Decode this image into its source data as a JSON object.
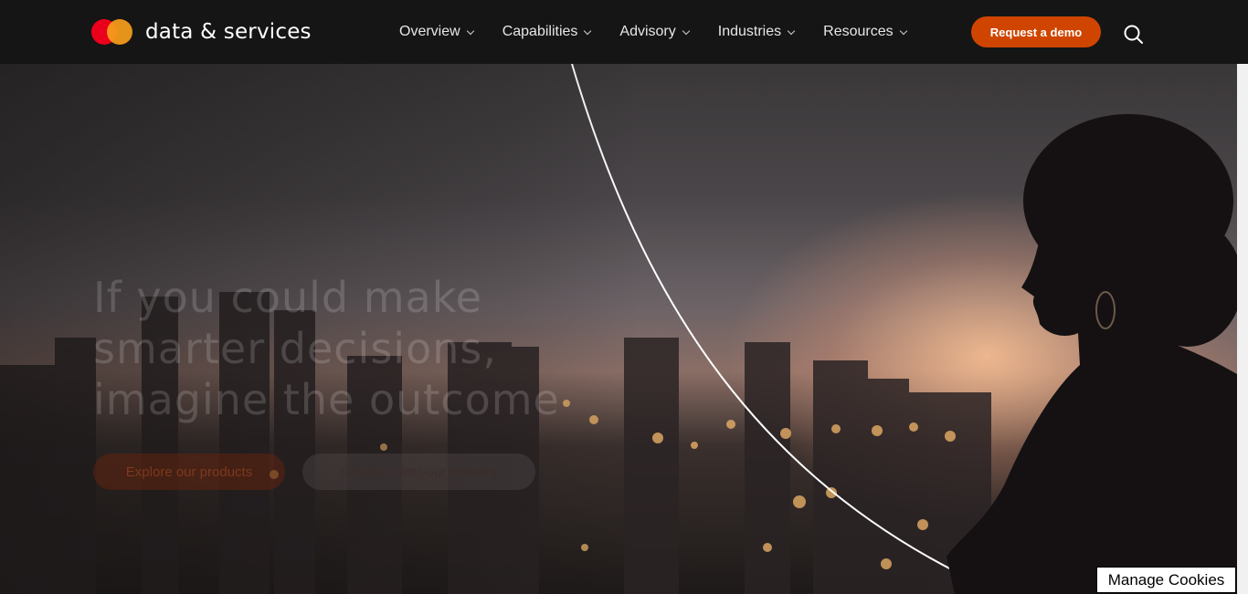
{
  "header": {
    "brand_name": "data & services",
    "nav": [
      {
        "label": "Overview"
      },
      {
        "label": "Capabilities"
      },
      {
        "label": "Advisory"
      },
      {
        "label": "Industries"
      },
      {
        "label": "Resources"
      }
    ],
    "cta_label": "Request a demo"
  },
  "hero": {
    "headline_line1": "If you could make",
    "headline_line2": "smarter decisions,",
    "headline_line3": "imagine the outcome",
    "primary_button": "Explore our products",
    "secondary_button": "Solutions for your industry"
  },
  "cookie": {
    "label": "Manage Cookies"
  },
  "colors": {
    "nav_background": "#151515",
    "brand_red": "#eb001b",
    "brand_orange": "#f79e1b",
    "cta": "#cf4500"
  }
}
